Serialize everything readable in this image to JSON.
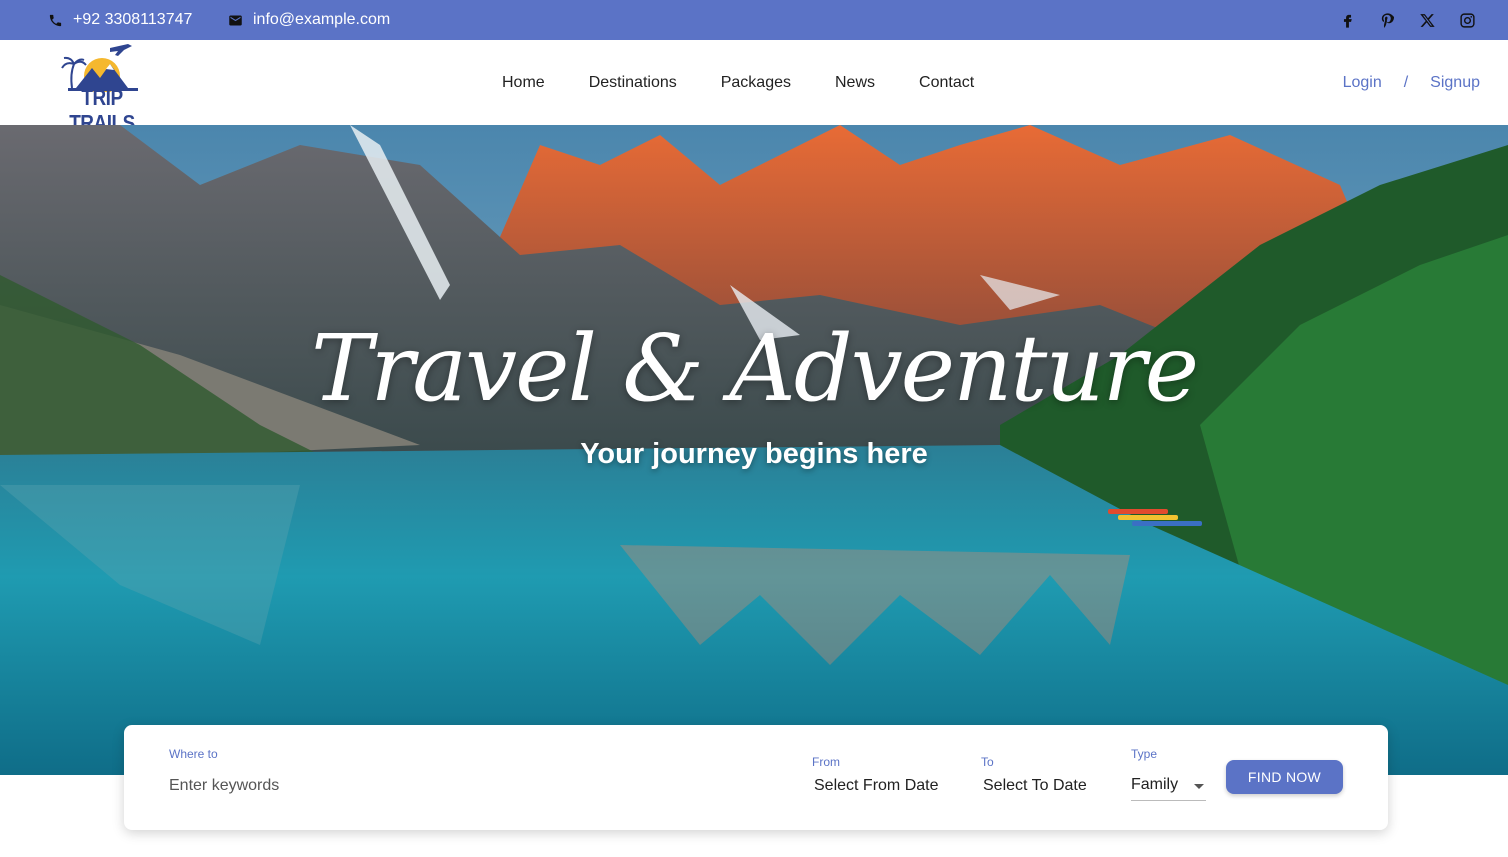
{
  "topbar": {
    "phone_icon": "phone-icon",
    "phone": "+92 3308113747",
    "email_icon": "mail-icon",
    "email": "info@example.com",
    "socials": [
      "facebook-icon",
      "pinterest-icon",
      "x-icon",
      "instagram-icon"
    ],
    "background": "#5b73c6"
  },
  "nav": {
    "logo_text": "TRIP TRAILS",
    "items": [
      {
        "label": "Home"
      },
      {
        "label": "Destinations"
      },
      {
        "label": "Packages"
      },
      {
        "label": "News"
      },
      {
        "label": "Contact"
      }
    ],
    "login": "Login",
    "separator": "/",
    "signup": "Signup",
    "accent": "#5b73c6"
  },
  "hero": {
    "title": "Travel & Adventure",
    "subtitle": "Your journey begins here"
  },
  "search": {
    "where_label": "Where to",
    "where_placeholder": "Enter keywords",
    "from_label": "From",
    "from_value": "Select From Date",
    "to_label": "To",
    "to_value": "Select To Date",
    "type_label": "Type",
    "type_value": "Family",
    "button": "FIND NOW"
  }
}
